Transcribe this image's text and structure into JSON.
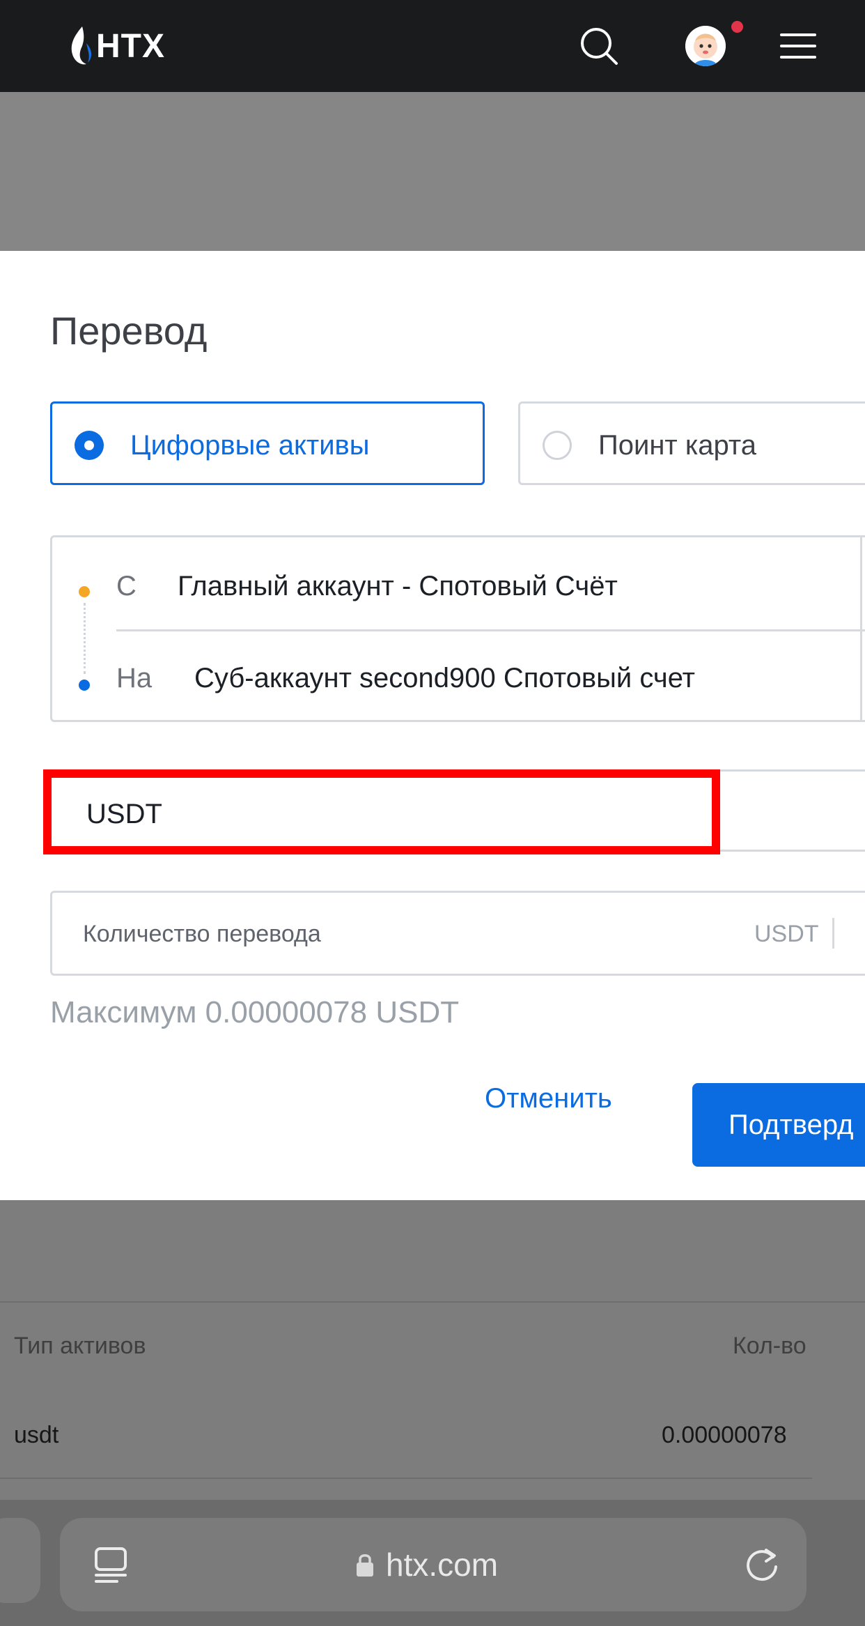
{
  "app": {
    "logo_text": "HTX"
  },
  "modal": {
    "title": "Перевод",
    "type_options": [
      {
        "label": "Цифорвые активы",
        "selected": true
      },
      {
        "label": "Поинт карта",
        "selected": false
      }
    ],
    "from_prefix": "С",
    "from_account": "Главный аккаунт - Спотовый Счёт",
    "to_prefix": "На",
    "to_account": "Суб-аккаунт second900 Спотовый счет",
    "coin": "USDT",
    "amount_placeholder": "Количество перевода",
    "amount_unit": "USDT",
    "max_text": "Максимум 0.00000078 USDT",
    "cancel_label": "Отменить",
    "confirm_label": "Подтверд"
  },
  "table": {
    "headers": [
      "Тип активов",
      "Кол-во"
    ],
    "rows": [
      {
        "type": "usdt",
        "qty": "0.00000078"
      }
    ]
  },
  "browser": {
    "url": "htx.com"
  },
  "colors": {
    "accent": "#0b6be0",
    "highlight": "#ff0000",
    "from_dot": "#f5a623",
    "notification": "#e4344a"
  }
}
